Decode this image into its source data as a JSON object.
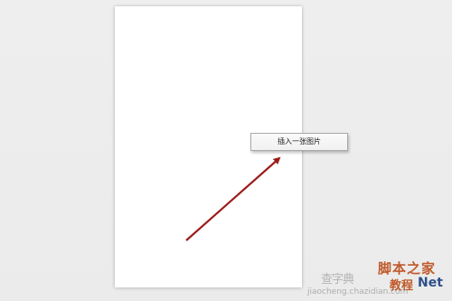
{
  "context_menu": {
    "items": [
      {
        "label": "插入一张图片"
      }
    ]
  },
  "annotation": {
    "arrow_color": "#9b1c1c"
  },
  "watermark": {
    "left_text": "查字典",
    "brand_line1": "脚本之家",
    "brand_line2": "教程",
    "brand_suffix": "Net",
    "url": "jiaocheng.chazidian.com"
  },
  "colors": {
    "background": "#ececec",
    "page": "#ffffff",
    "menu_border": "#a9a9a9"
  }
}
